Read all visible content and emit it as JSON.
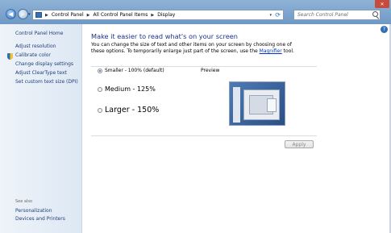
{
  "window": {
    "close_glyph": "✕"
  },
  "nav": {
    "back_glyph": "◀",
    "forward_glyph": "▶",
    "dropdown_glyph": "▾",
    "refresh_glyph": "⟳"
  },
  "address": {
    "breadcrumbs": [
      "Control Panel",
      "All Control Panel Items",
      "Display"
    ],
    "separator": "▶",
    "dropdown_glyph": "▾"
  },
  "search": {
    "placeholder": "Search Control Panel"
  },
  "sidebar": {
    "home": "Control Panel Home",
    "items": [
      "Adjust resolution",
      "Calibrate color",
      "Change display settings",
      "Adjust ClearType text",
      "Set custom text size (DPI)"
    ],
    "see_also_title": "See also",
    "see_also": [
      "Personalization",
      "Devices and Printers"
    ]
  },
  "main": {
    "heading": "Make it easier to read what's on your screen",
    "description_prefix": "You can change the size of text and other items on your screen by choosing one of these options. To temporarily enlarge just part of the screen, use the ",
    "magnifier_link": "Magnifier",
    "description_suffix": " tool.",
    "options": [
      {
        "label": "Smaller - 100% (default)",
        "selected": true
      },
      {
        "label": "Medium - 125%",
        "selected": false
      },
      {
        "label": "Larger - 150%",
        "selected": false
      }
    ],
    "preview_label": "Preview",
    "apply_label": "Apply",
    "help_glyph": "?"
  },
  "colors": {
    "titlebar": "#6f98c6",
    "link": "#1f3f78",
    "heading": "#1e3287",
    "accent": "#2f6fb6"
  }
}
